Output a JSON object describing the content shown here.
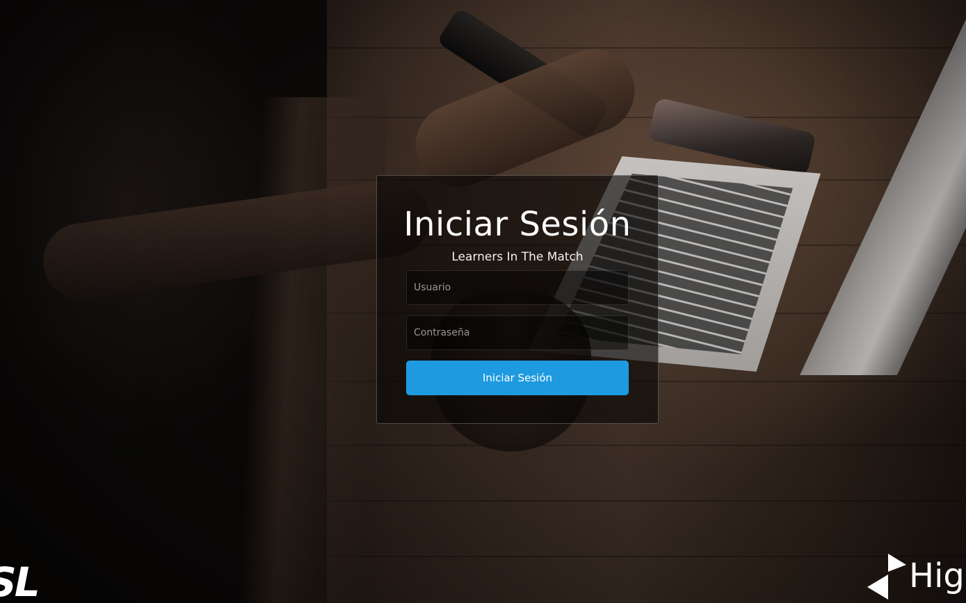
{
  "login": {
    "title": "Iniciar Sesión",
    "subtitle": "Learners In The Match",
    "username_placeholder": "Usuario",
    "password_placeholder": "Contraseña",
    "submit_label": "Iniciar Sesión"
  },
  "logos": {
    "left_text": "SL",
    "right_text": "Hig"
  },
  "colors": {
    "button_bg": "#1e9ae0",
    "panel_bg": "rgba(8,6,5,0.62)",
    "text": "#ffffff"
  }
}
